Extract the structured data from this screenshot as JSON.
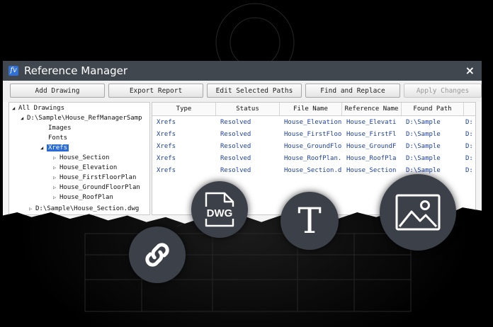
{
  "window": {
    "title": "Reference Manager",
    "close_glyph": "×"
  },
  "toolbar": {
    "add_drawing": "Add Drawing",
    "export_report": "Export Report",
    "edit_selected_paths": "Edit Selected Paths",
    "find_and_replace": "Find and Replace",
    "apply_changes": "Apply Changes"
  },
  "tree": {
    "root": "All Drawings",
    "drawing1": "D:\\Sample\\House_RefManagerSamp",
    "images": "Images",
    "fonts": "Fonts",
    "xrefs": "Xrefs",
    "xref_items": [
      "House_Section",
      "House_Elevation",
      "House_FirstFloorPlan",
      "House_GroundFloorPlan",
      "House_RoofPlan"
    ],
    "drawing2": "D:\\Sample\\House_Section.dwg"
  },
  "table": {
    "headers": [
      "Type",
      "Status",
      "File Name",
      "Reference Name",
      "Found Path"
    ],
    "rows": [
      [
        "Xrefs",
        "Resolved",
        "House_Elevation",
        "House_Elevati",
        "D:\\Sample",
        "D:"
      ],
      [
        "Xrefs",
        "Resolved",
        "House_FirstFloo",
        "House_FirstFl",
        "D:\\Sample",
        "D:"
      ],
      [
        "Xrefs",
        "Resolved",
        "House_GroundFlo",
        "House_GroundF",
        "D:\\Sample",
        "D:"
      ],
      [
        "Xrefs",
        "Resolved",
        "House_RoofPlan.",
        "House_RoofPla",
        "D:\\Sample",
        "D:"
      ],
      [
        "Xrefs",
        "Resolved",
        "House_Section.d",
        "House_Section",
        "D:\\Sample",
        "D:"
      ]
    ]
  },
  "badges": {
    "dwg_label": "DWG",
    "text_label": "T"
  },
  "colors": {
    "titlebar": "#41474f",
    "selection": "#2a6bd5",
    "cell_text": "#1c3fa8",
    "badge": "#3c4048"
  }
}
